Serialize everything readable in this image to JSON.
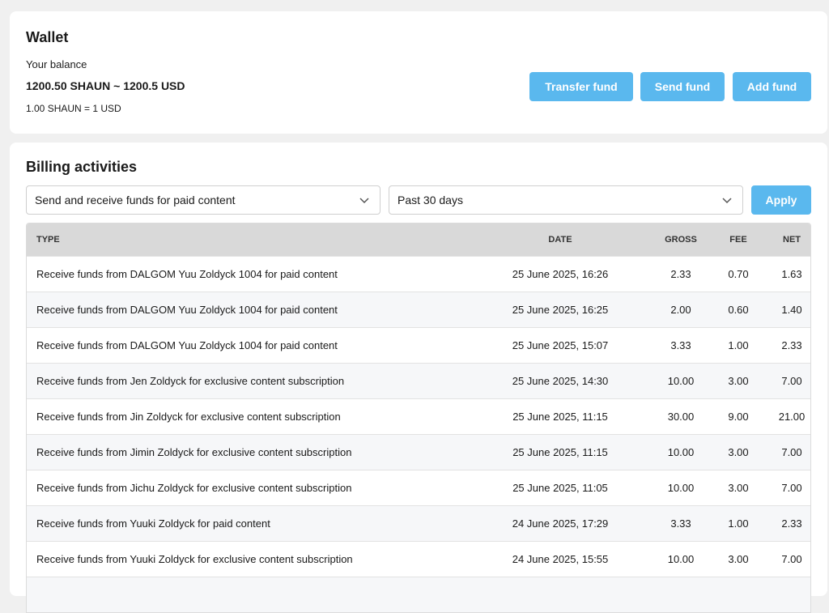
{
  "wallet": {
    "title": "Wallet",
    "balance_label": "Your balance",
    "balance_value": "1200.50 SHAUN ~ 1200.5 USD",
    "rate": "1.00 SHAUN = 1 USD",
    "buttons": {
      "transfer": "Transfer fund",
      "send": "Send fund",
      "add": "Add fund"
    }
  },
  "billing": {
    "title": "Billing activities",
    "type_filter": "Send and receive funds for paid content",
    "period_filter": "Past 30 days",
    "apply_label": "Apply",
    "columns": [
      "TYPE",
      "DATE",
      "GROSS",
      "FEE",
      "NET"
    ],
    "rows": [
      [
        "Receive funds from DALGOM Yuu Zoldyck 1004 for paid content",
        "25 June 2025, 16:26",
        "2.33",
        "0.70",
        "1.63"
      ],
      [
        "Receive funds from DALGOM Yuu Zoldyck 1004 for paid content",
        "25 June 2025, 16:25",
        "2.00",
        "0.60",
        "1.40"
      ],
      [
        "Receive funds from DALGOM Yuu Zoldyck 1004 for paid content",
        "25 June 2025, 15:07",
        "3.33",
        "1.00",
        "2.33"
      ],
      [
        "Receive funds from Jen Zoldyck for exclusive content subscription",
        "25 June 2025, 14:30",
        "10.00",
        "3.00",
        "7.00"
      ],
      [
        "Receive funds from Jin Zoldyck for exclusive content subscription",
        "25 June 2025, 11:15",
        "30.00",
        "9.00",
        "21.00"
      ],
      [
        "Receive funds from Jimin Zoldyck for exclusive content subscription",
        "25 June 2025, 11:15",
        "10.00",
        "3.00",
        "7.00"
      ],
      [
        "Receive funds from Jichu Zoldyck for exclusive content subscription",
        "25 June 2025, 11:05",
        "10.00",
        "3.00",
        "7.00"
      ],
      [
        "Receive funds from Yuuki Zoldyck for paid content",
        "24 June 2025, 17:29",
        "3.33",
        "1.00",
        "2.33"
      ],
      [
        "Receive funds from Yuuki Zoldyck for exclusive content subscription",
        "24 June 2025, 15:55",
        "10.00",
        "3.00",
        "7.00"
      ],
      [
        "",
        "",
        "",
        "",
        ""
      ]
    ]
  },
  "icons": {
    "select_arrow": "chevron-down-icon"
  },
  "colors": {
    "accent": "#5ab8ee",
    "page_bg": "#f0f0f0",
    "header_bg": "#d9d9d9"
  }
}
